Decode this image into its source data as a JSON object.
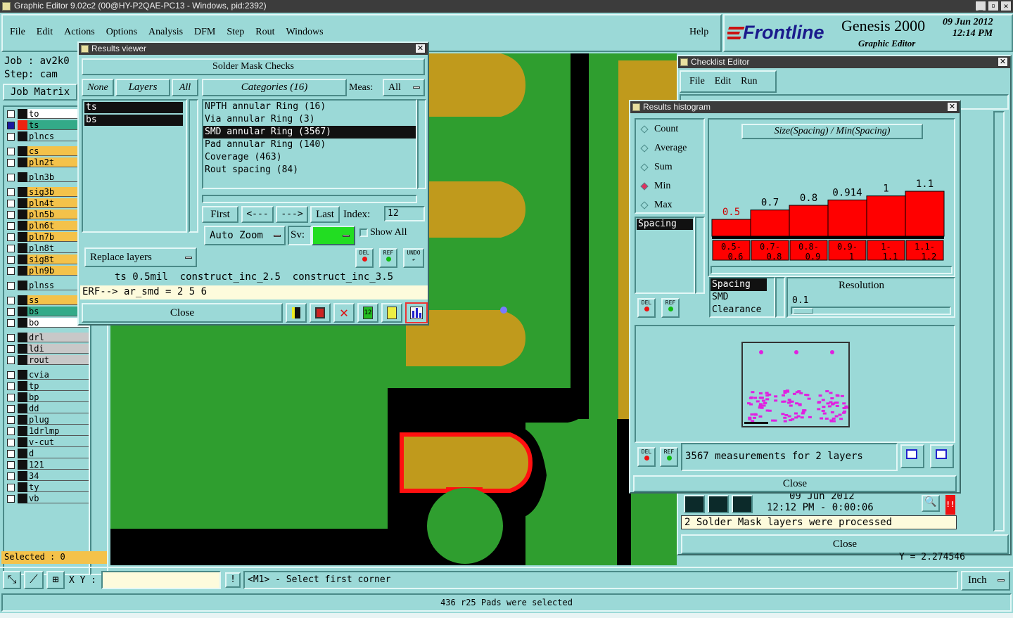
{
  "app": {
    "title": "Graphic Editor 9.02c2 (00@HY-P2QAE-PC13 - Windows, pid:2392)"
  },
  "menu": [
    "File",
    "Edit",
    "Actions",
    "Options",
    "Analysis",
    "DFM",
    "Step",
    "Rout",
    "Windows"
  ],
  "help": "Help",
  "brand": {
    "logo": "Frontline",
    "product": "Genesis 2000",
    "sub": "Graphic Editor",
    "date": "09 Jun 2012",
    "time": "12:14 PM"
  },
  "job": {
    "job": "Job : av2k0",
    "step": "Step: cam",
    "matrix": "Job Matrix"
  },
  "layers": [
    {
      "name": "to",
      "color": "#ffffff",
      "sel": false
    },
    {
      "name": "ts",
      "color": "#33aa88",
      "sel": true
    },
    {
      "name": "plncs",
      "color": "#9bd9d7",
      "sel": false
    },
    {
      "name": "cs",
      "color": "#f4c24a",
      "sel": false
    },
    {
      "name": "pln2t",
      "color": "#f4c24a",
      "sel": false
    },
    {
      "name": "pln3b",
      "color": "#9bd9d7",
      "sel": false
    },
    {
      "name": "sig3b",
      "color": "#f4c24a",
      "sel": false
    },
    {
      "name": "pln4t",
      "color": "#f4c24a",
      "sel": false
    },
    {
      "name": "pln5b",
      "color": "#f4c24a",
      "sel": false
    },
    {
      "name": "pln6t",
      "color": "#f4c24a",
      "sel": false
    },
    {
      "name": "pln7b",
      "color": "#f4c24a",
      "sel": false
    },
    {
      "name": "pln8t",
      "color": "#9bd9d7",
      "sel": false
    },
    {
      "name": "sig8t",
      "color": "#f4c24a",
      "sel": false
    },
    {
      "name": "pln9b",
      "color": "#f4c24a",
      "sel": false
    },
    {
      "name": "plnss",
      "color": "#9bd9d7",
      "sel": false
    },
    {
      "name": "ss",
      "color": "#f4c24a",
      "sel": false
    },
    {
      "name": "bs",
      "color": "#33aa88",
      "sel": false
    },
    {
      "name": "bo",
      "color": "#ffffff",
      "sel": false
    },
    {
      "name": "drl",
      "color": "#c8c8c8",
      "sel": false
    },
    {
      "name": "ldi",
      "color": "#c8c8c8",
      "sel": false
    },
    {
      "name": "rout",
      "color": "#c8c8c8",
      "sel": false
    },
    {
      "name": "cvia",
      "color": "#9bd9d7",
      "sel": false
    },
    {
      "name": "tp",
      "color": "#9bd9d7",
      "sel": false
    },
    {
      "name": "bp",
      "color": "#9bd9d7",
      "sel": false
    },
    {
      "name": "dd",
      "color": "#9bd9d7",
      "sel": false
    },
    {
      "name": "plug",
      "color": "#9bd9d7",
      "sel": false
    },
    {
      "name": "1drlmp",
      "color": "#9bd9d7",
      "sel": false
    },
    {
      "name": "v-cut",
      "color": "#9bd9d7",
      "sel": false
    },
    {
      "name": "d",
      "color": "#9bd9d7",
      "sel": false
    },
    {
      "name": "121",
      "color": "#9bd9d7",
      "sel": false
    },
    {
      "name": "34",
      "color": "#9bd9d7",
      "sel": false
    },
    {
      "name": "ty",
      "color": "#9bd9d7",
      "sel": false
    },
    {
      "name": "vb",
      "color": "#9bd9d7",
      "sel": false
    }
  ],
  "selected": "Selected : 0",
  "results": {
    "title": "Results viewer",
    "header": "Solder Mask Checks",
    "none": "None",
    "layers_btn": "Layers",
    "all": "All",
    "layer_list": [
      "ts",
      "bs"
    ],
    "categories": "Categories (16)",
    "meas_label": "Meas:",
    "meas_value": "All",
    "cat_list": [
      "NPTH annular Ring (16)",
      "Via annular Ring (3)",
      "SMD annular Ring (3567)",
      "Pad annular Ring (140)",
      "Coverage (463)",
      "Rout spacing (84)"
    ],
    "first": "First",
    "prev": "<---",
    "next": "--->",
    "last": "Last",
    "index_label": "Index:",
    "index_value": "12",
    "auto_zoom": "Auto Zoom",
    "sv": "Sv:",
    "show_all": "Show All",
    "replace_layers": "Replace layers",
    "del": "DEL",
    "ref": "REF",
    "undo": "UNDO",
    "info": "ts 0.5mil  construct_inc_2.5  construct_inc_3.5",
    "erf": "ERF--> ar_smd = 2 5 6",
    "close": "Close"
  },
  "checklist": {
    "title": "Checklist Editor",
    "menu": [
      "File",
      "Edit",
      "Run"
    ],
    "date": "09 Jun 2012",
    "time": "12:12 PM - 0:00:06",
    "msg": "2 Solder Mask layers were processed",
    "close": "Close",
    "coord": "Y = 2.274546"
  },
  "histogram": {
    "title": "Results histogram",
    "modes": [
      "Count",
      "Average",
      "Sum",
      "Min",
      "Max"
    ],
    "mode_selected": "Min",
    "heading": "Size(Spacing) / Min(Spacing)",
    "type_list": [
      "Spacing"
    ],
    "sort_list": [
      "Spacing",
      "SMD",
      "Clearance"
    ],
    "resolution_label": "Resolution",
    "resolution_value": "0.1",
    "summary": "3567 measurements for 2 layers",
    "close": "Close",
    "del": "DEL",
    "ref": "REF"
  },
  "chart_data": {
    "type": "bar",
    "title": "Size(Spacing) / Min(Spacing)",
    "categories": [
      "0.5-0.6",
      "0.7-0.8",
      "0.8-0.9",
      "0.9-1",
      "1-1.1",
      "1.1-1.2"
    ],
    "values": [
      0.5,
      0.7,
      0.8,
      0.914,
      1,
      1.1
    ],
    "value_labels": [
      "0.5",
      "0.7",
      "0.8",
      "0.914",
      "1",
      "1.1"
    ],
    "color": "#ff0000",
    "label_color_first": "#cc0000"
  },
  "status": {
    "xy_label": "X Y :",
    "xy_value": "",
    "prompt": "<M1> - Select first corner",
    "unit": "Inch",
    "bottom": "436 r25 Pads were selected"
  },
  "colors": {
    "teal": "#9bd9d7",
    "board": "#2f9e2f",
    "pad": "#c09a1c",
    "mark": "#ff0000",
    "black": "#000000"
  }
}
